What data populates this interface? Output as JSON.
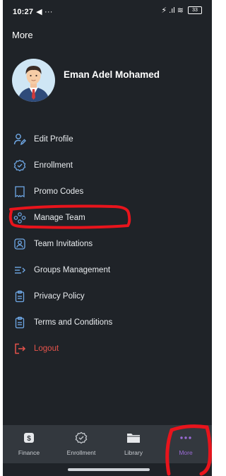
{
  "status_bar": {
    "time": "10:27",
    "extra": "◀ ···",
    "icons": "⚡ .ıl ≋",
    "battery": "33"
  },
  "header": {
    "title": "More"
  },
  "profile": {
    "name": "Eman Adel Mohamed"
  },
  "menu": {
    "items": [
      {
        "label": "Edit Profile",
        "icon": "user-edit-icon"
      },
      {
        "label": "Enrollment",
        "icon": "check-badge-icon"
      },
      {
        "label": "Promo Codes",
        "icon": "ticket-icon"
      },
      {
        "label": "Manage Team",
        "icon": "team-icon"
      },
      {
        "label": "Team Invitations",
        "icon": "invitation-icon"
      },
      {
        "label": "Groups Management",
        "icon": "groups-icon"
      },
      {
        "label": "Privacy Policy",
        "icon": "clipboard-icon"
      },
      {
        "label": "Terms and Conditions",
        "icon": "clipboard-icon"
      },
      {
        "label": "Logout",
        "icon": "logout-icon"
      }
    ]
  },
  "bottom_nav": {
    "items": [
      {
        "label": "Finance",
        "icon": "dollar-icon"
      },
      {
        "label": "Enrollment",
        "icon": "check-badge-icon"
      },
      {
        "label": "Library",
        "icon": "folder-icon"
      },
      {
        "label": "More",
        "icon": "more-dots-icon",
        "active": true
      }
    ]
  },
  "colors": {
    "background": "#1f2328",
    "nav_background": "#33383e",
    "accent_purple": "#9b6bd6",
    "icon_blue": "#6fa8e6",
    "logout_red": "#e5534b",
    "annotation_red": "#e8141c"
  }
}
